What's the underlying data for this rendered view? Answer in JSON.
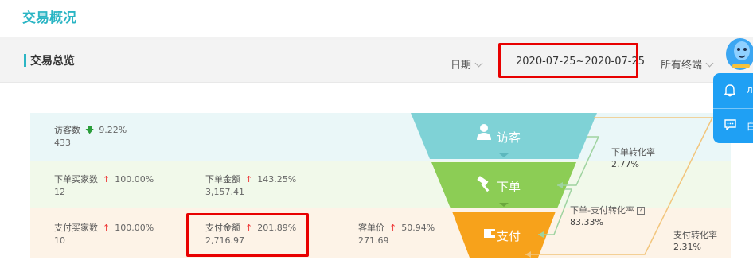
{
  "page": {
    "title": "交易概况"
  },
  "section": {
    "title": "交易总览"
  },
  "filters": {
    "date_label": "日期",
    "date_range": "2020-07-25~2020-07-25",
    "terminal": "所有终端"
  },
  "metrics": {
    "visitors": {
      "label": "访客数",
      "change": "9.22%",
      "value": "433",
      "direction": "down"
    },
    "order_buyers": {
      "label": "下单买家数",
      "change": "100.00%",
      "value": "12",
      "direction": "up"
    },
    "order_amount": {
      "label": "下单金额",
      "change": "143.25%",
      "value": "3,157.41",
      "direction": "up"
    },
    "pay_buyers": {
      "label": "支付买家数",
      "change": "100.00%",
      "value": "10",
      "direction": "up"
    },
    "pay_amount": {
      "label": "支付金额",
      "change": "201.89%",
      "value": "2,716.97",
      "direction": "up"
    },
    "unit_price": {
      "label": "客单价",
      "change": "50.94%",
      "value": "271.69",
      "direction": "up"
    }
  },
  "funnel": {
    "stages": [
      {
        "label": "访客",
        "color": "#7fd2d6"
      },
      {
        "label": "下单",
        "color": "#8ccd55"
      },
      {
        "label": "支付",
        "color": "#f7a21b"
      }
    ],
    "conversions": {
      "order_rate": {
        "label": "下单转化率",
        "value": "2.77%"
      },
      "order_pay_rate": {
        "label": "下单-支付转化率",
        "value": "83.33%"
      },
      "pay_rate": {
        "label": "支付转化率",
        "value": "2.31%"
      }
    }
  },
  "side_panel": {
    "bell_text": "л",
    "chat_text": "白"
  },
  "colors": {
    "accent": "#2bb5c4",
    "highlight": "#e80000",
    "panel": "#1fa0f4"
  }
}
